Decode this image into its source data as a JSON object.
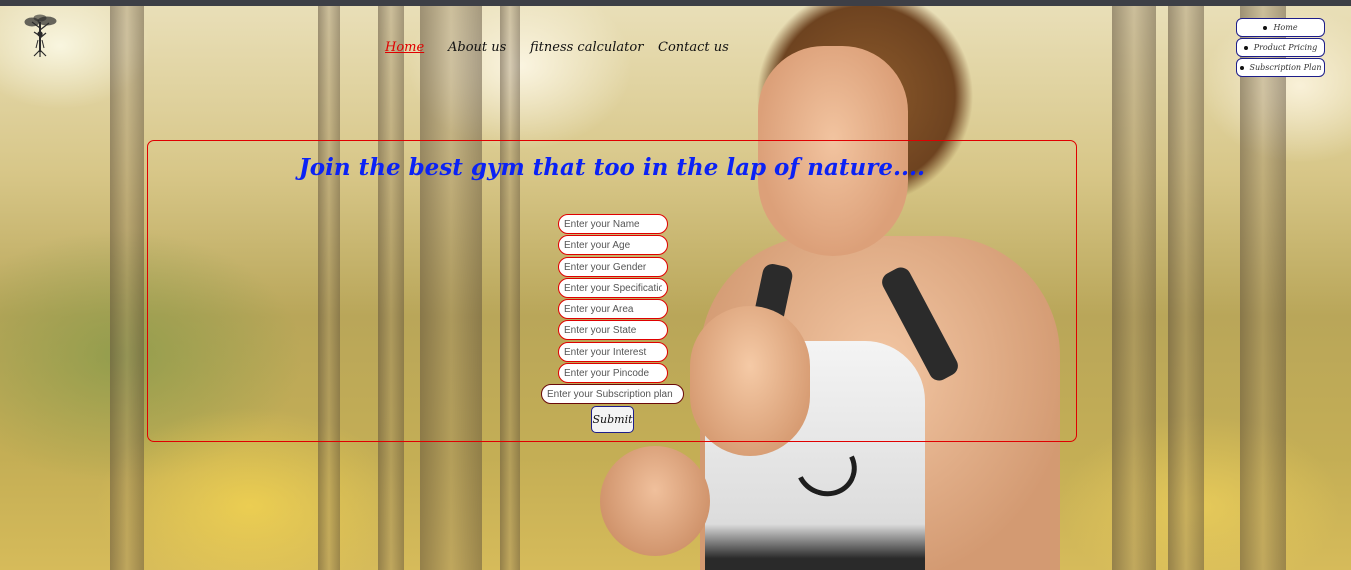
{
  "nav": {
    "items": [
      {
        "label": "Home",
        "active": true
      },
      {
        "label": "About us",
        "active": false
      },
      {
        "label": "fitness calculator",
        "active": false
      },
      {
        "label": "Contact us",
        "active": false
      }
    ]
  },
  "side_menu": {
    "items": [
      {
        "label": "Home"
      },
      {
        "label": "Product Pricing"
      },
      {
        "label": "Subscription Plan"
      }
    ]
  },
  "headline": "Join the best gym that too in the lap of nature....",
  "form": {
    "fields": [
      {
        "placeholder": "Enter your Name",
        "value": ""
      },
      {
        "placeholder": "Enter your Age",
        "value": ""
      },
      {
        "placeholder": "Enter your Gender",
        "value": ""
      },
      {
        "placeholder": "Enter your Specification",
        "value": ""
      },
      {
        "placeholder": "Enter your Area",
        "value": ""
      },
      {
        "placeholder": "Enter your State",
        "value": ""
      },
      {
        "placeholder": "Enter your Interest",
        "value": ""
      },
      {
        "placeholder": "Enter your Pincode",
        "value": ""
      },
      {
        "placeholder": "Enter your Subscription plan",
        "value": ""
      }
    ],
    "submit_label": "Submit"
  },
  "icons": {
    "logo": "tree-logo-icon",
    "menu_bullet": "bullet-icon"
  },
  "colors": {
    "headline": "#0b22f5",
    "panel_border": "#e00000",
    "field_border": "#e00000",
    "nav_active": "#e00000",
    "side_menu_border": "#1e1e8a"
  }
}
